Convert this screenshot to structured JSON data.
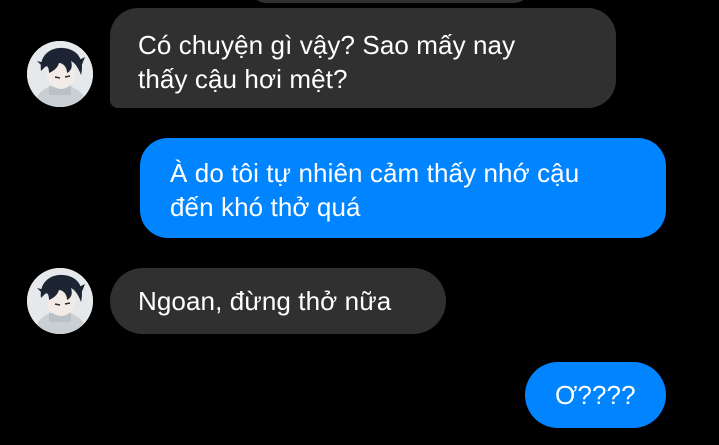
{
  "conversation": {
    "messages": [
      {
        "sender": "contact",
        "text": "Có chuyện gì vậy? Sao mấy nay\nthấy cậu hơi mệt?"
      },
      {
        "sender": "me",
        "text": "À do tôi tự nhiên cảm thấy nhớ cậu\nđến khó thở quá"
      },
      {
        "sender": "contact",
        "text": "Ngoan, đừng thở nữa"
      },
      {
        "sender": "me",
        "text": "Ơ????"
      }
    ]
  },
  "colors": {
    "background": "#000000",
    "incoming_bubble": "#303030",
    "outgoing_bubble": "#0084ff",
    "text": "#ffffff"
  },
  "icons": {
    "contact_avatar": "anime-boy-avatar"
  }
}
